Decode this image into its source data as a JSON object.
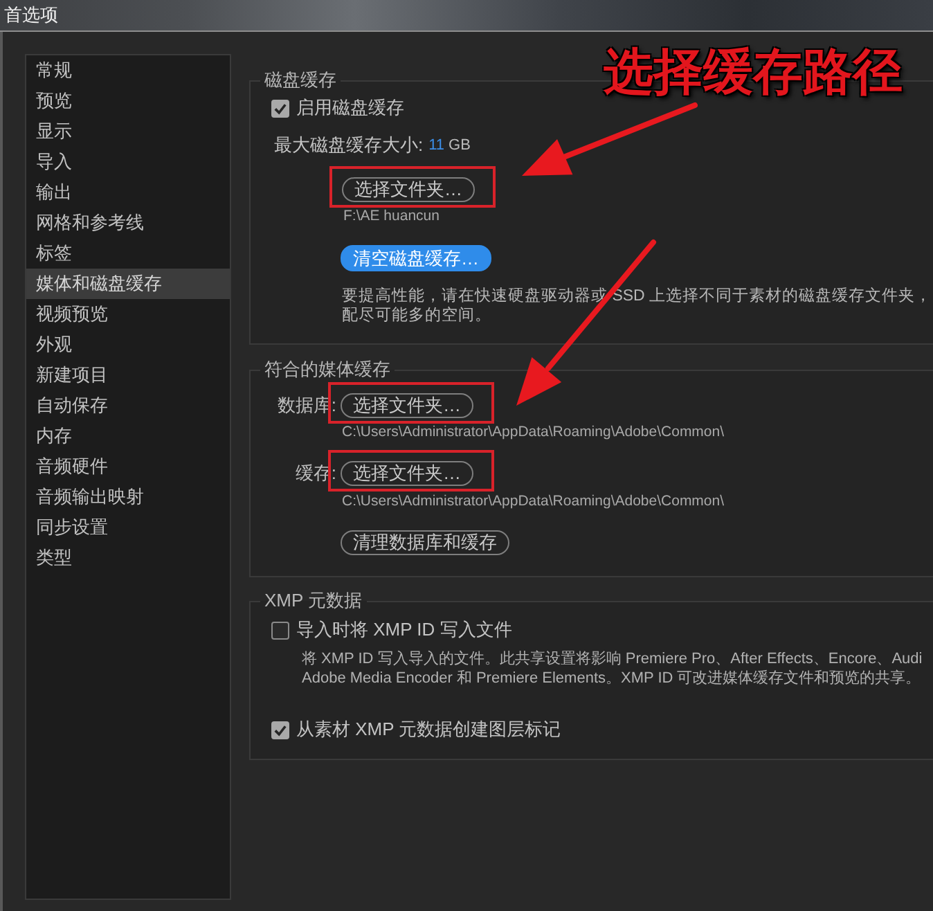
{
  "window": {
    "title": "首选项"
  },
  "sidebar": {
    "items": [
      {
        "label": "常规",
        "selected": false
      },
      {
        "label": "预览",
        "selected": false
      },
      {
        "label": "显示",
        "selected": false
      },
      {
        "label": "导入",
        "selected": false
      },
      {
        "label": "输出",
        "selected": false
      },
      {
        "label": "网格和参考线",
        "selected": false
      },
      {
        "label": "标签",
        "selected": false
      },
      {
        "label": "媒体和磁盘缓存",
        "selected": true
      },
      {
        "label": "视频预览",
        "selected": false
      },
      {
        "label": "外观",
        "selected": false
      },
      {
        "label": "新建项目",
        "selected": false
      },
      {
        "label": "自动保存",
        "selected": false
      },
      {
        "label": "内存",
        "selected": false
      },
      {
        "label": "音频硬件",
        "selected": false
      },
      {
        "label": "音频输出映射",
        "selected": false
      },
      {
        "label": "同步设置",
        "selected": false
      },
      {
        "label": "类型",
        "selected": false
      }
    ]
  },
  "callout": {
    "text": "选择缓存路径"
  },
  "disk_cache": {
    "heading": "磁盘缓存",
    "enable": {
      "label": "启用磁盘缓存",
      "checked": true
    },
    "max_size": {
      "label": "最大磁盘缓存大小:",
      "value": "11",
      "unit": "GB"
    },
    "select_button": {
      "label": "选择文件夹…",
      "highlighted": true
    },
    "path": "F:\\AE huancun",
    "clear_button": {
      "label": "清空磁盘缓存…"
    },
    "note_lines": [
      "要提高性能，请在快速硬盘驱动器或 SSD 上选择不同于素材的磁盘缓存文件夹，",
      "配尽可能多的空间。"
    ]
  },
  "media_cache": {
    "heading": "符合的媒体缓存",
    "locations": [
      {
        "label": "数据库:",
        "button": {
          "label": "选择文件夹…",
          "highlighted": true
        },
        "path": "C:\\Users\\Administrator\\AppData\\Roaming\\Adobe\\Common\\"
      },
      {
        "label": "缓存:",
        "button": {
          "label": "选择文件夹…",
          "highlighted": true
        },
        "path": "C:\\Users\\Administrator\\AppData\\Roaming\\Adobe\\Common\\"
      }
    ],
    "clean_button": {
      "label": "清理数据库和缓存"
    }
  },
  "xmp": {
    "heading": "XMP 元数据",
    "options": [
      {
        "label": "导入时将 XMP ID 写入文件",
        "checked": false,
        "description_lines": [
          "将 XMP ID 写入导入的文件。此共享设置将影响 Premiere Pro、After Effects、Encore、Audi",
          "Adobe Media Encoder 和 Premiere Elements。XMP ID 可改进媒体缓存文件和预览的共享。"
        ]
      },
      {
        "label": "从素材 XMP 元数据创建图层标记",
        "checked": true
      }
    ]
  }
}
